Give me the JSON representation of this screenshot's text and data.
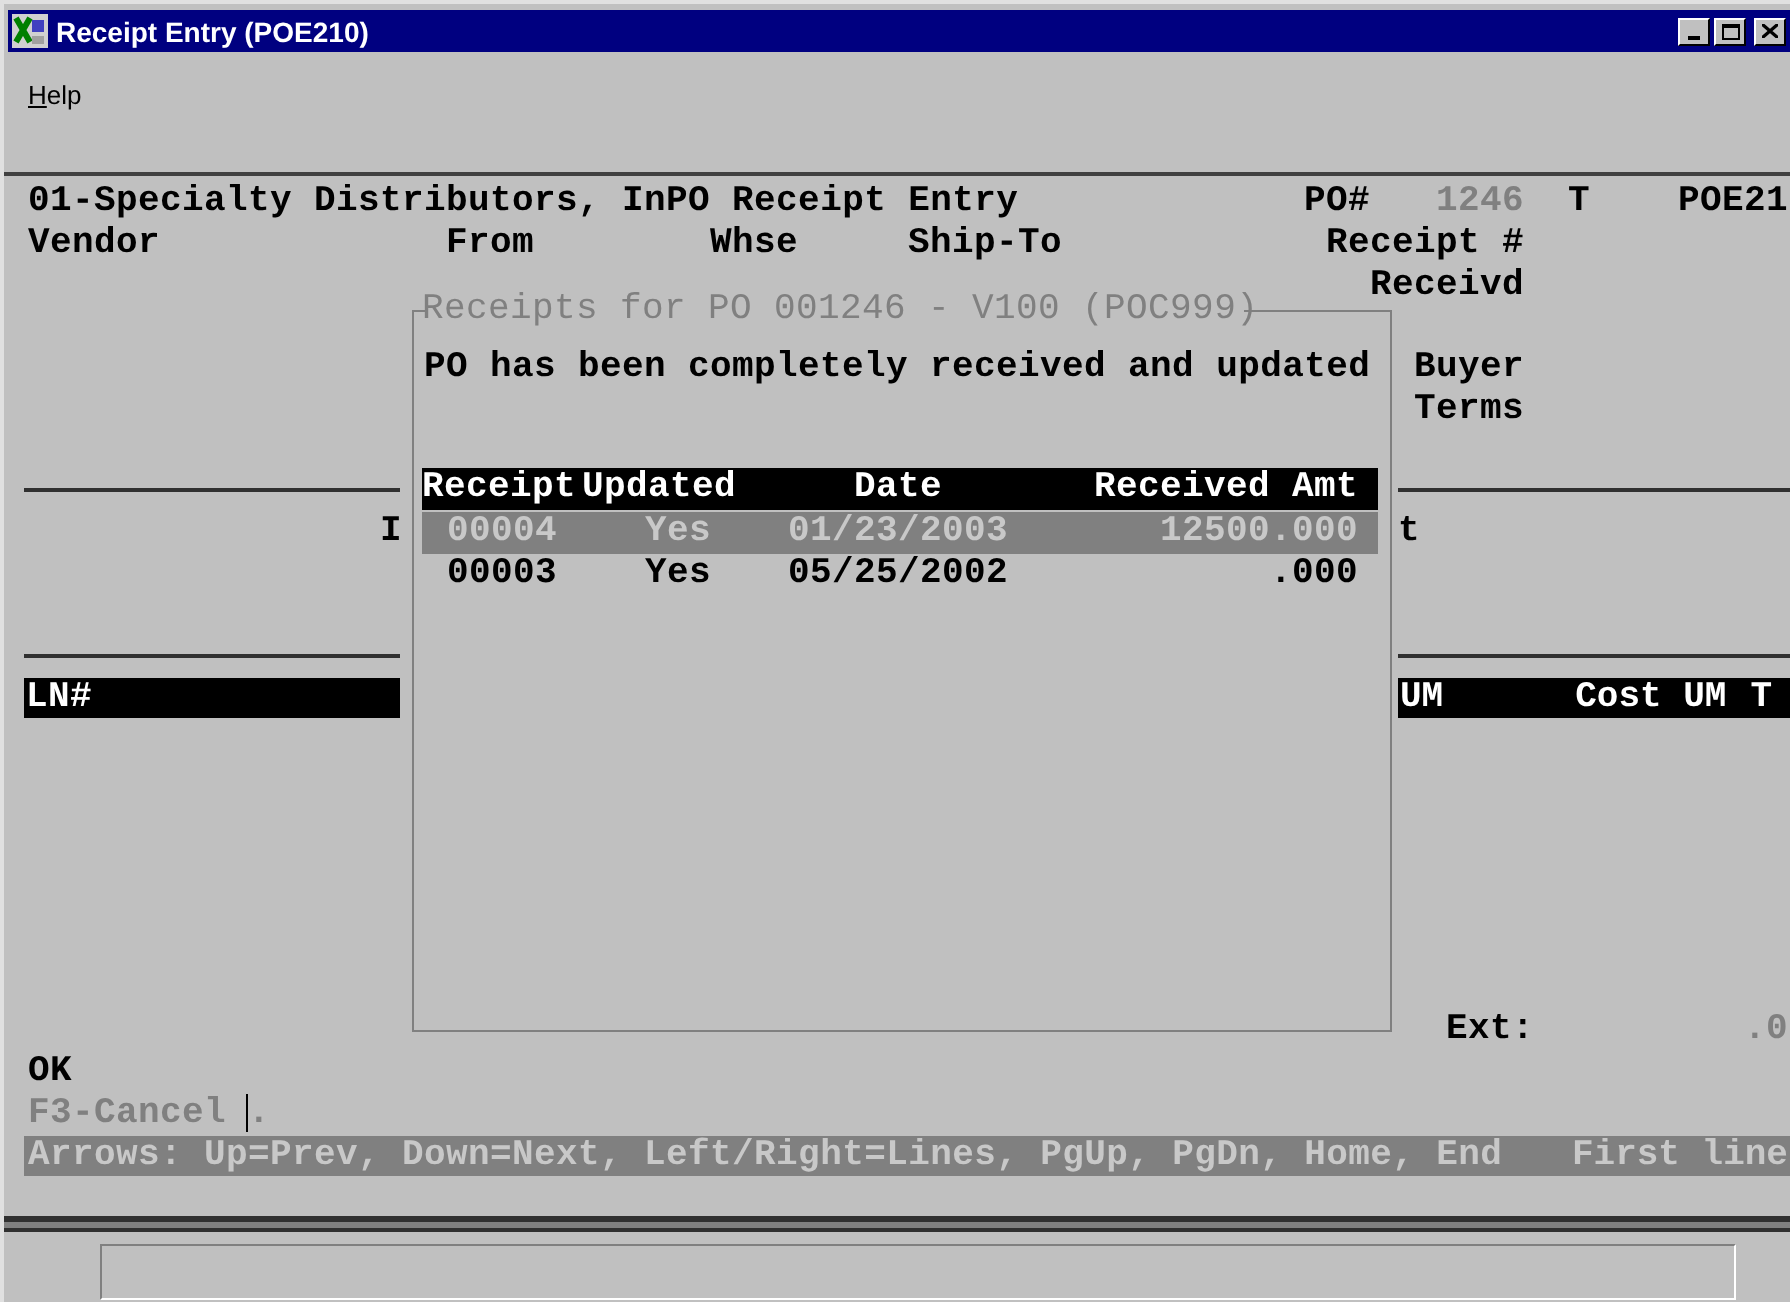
{
  "window": {
    "title": "Receipt Entry (POE210)"
  },
  "menu": [
    {
      "label": "Help"
    }
  ],
  "header": {
    "title_line": "01-Specialty Distributors, InPO Receipt Entry",
    "po_label": "PO#",
    "po_number": "1246",
    "po_flag": "T",
    "program_id": "POE21"
  },
  "labels": {
    "vendor": "Vendor",
    "from": "From",
    "whse": "Whse",
    "ship_to": "Ship-To",
    "receipt_no": "Receipt #",
    "received": "Receivd",
    "buyer": "Buyer",
    "terms": "Terms",
    "fragment_left": "I",
    "fragment_right": "t"
  },
  "lines_header": {
    "left": "LN#",
    "right": [
      "UM",
      "Cost UM",
      "T"
    ]
  },
  "dialog": {
    "title": "Receipts for PO 001246 - V100 (POC999)",
    "message": "PO has been completely received and updated",
    "columns": [
      "Receipt",
      "Updated",
      "Date",
      "Received Amt"
    ],
    "rows": [
      {
        "cells": [
          "00004",
          "Yes",
          "01/23/2003",
          "12500.000"
        ],
        "selected": true
      },
      {
        "cells": [
          "00003",
          "Yes",
          "05/25/2002",
          ".000"
        ],
        "selected": false
      }
    ]
  },
  "totals": {
    "ext_label": "Ext:",
    "ext_value": ".0"
  },
  "prompt": {
    "ok": "OK",
    "cancel": "F3-Cancel",
    "input": "."
  },
  "status_bar": {
    "help": "Arrows: Up=Prev, Down=Next, Left/Right=Lines, PgUp, PgDn, Home, End",
    "message": "First line"
  }
}
